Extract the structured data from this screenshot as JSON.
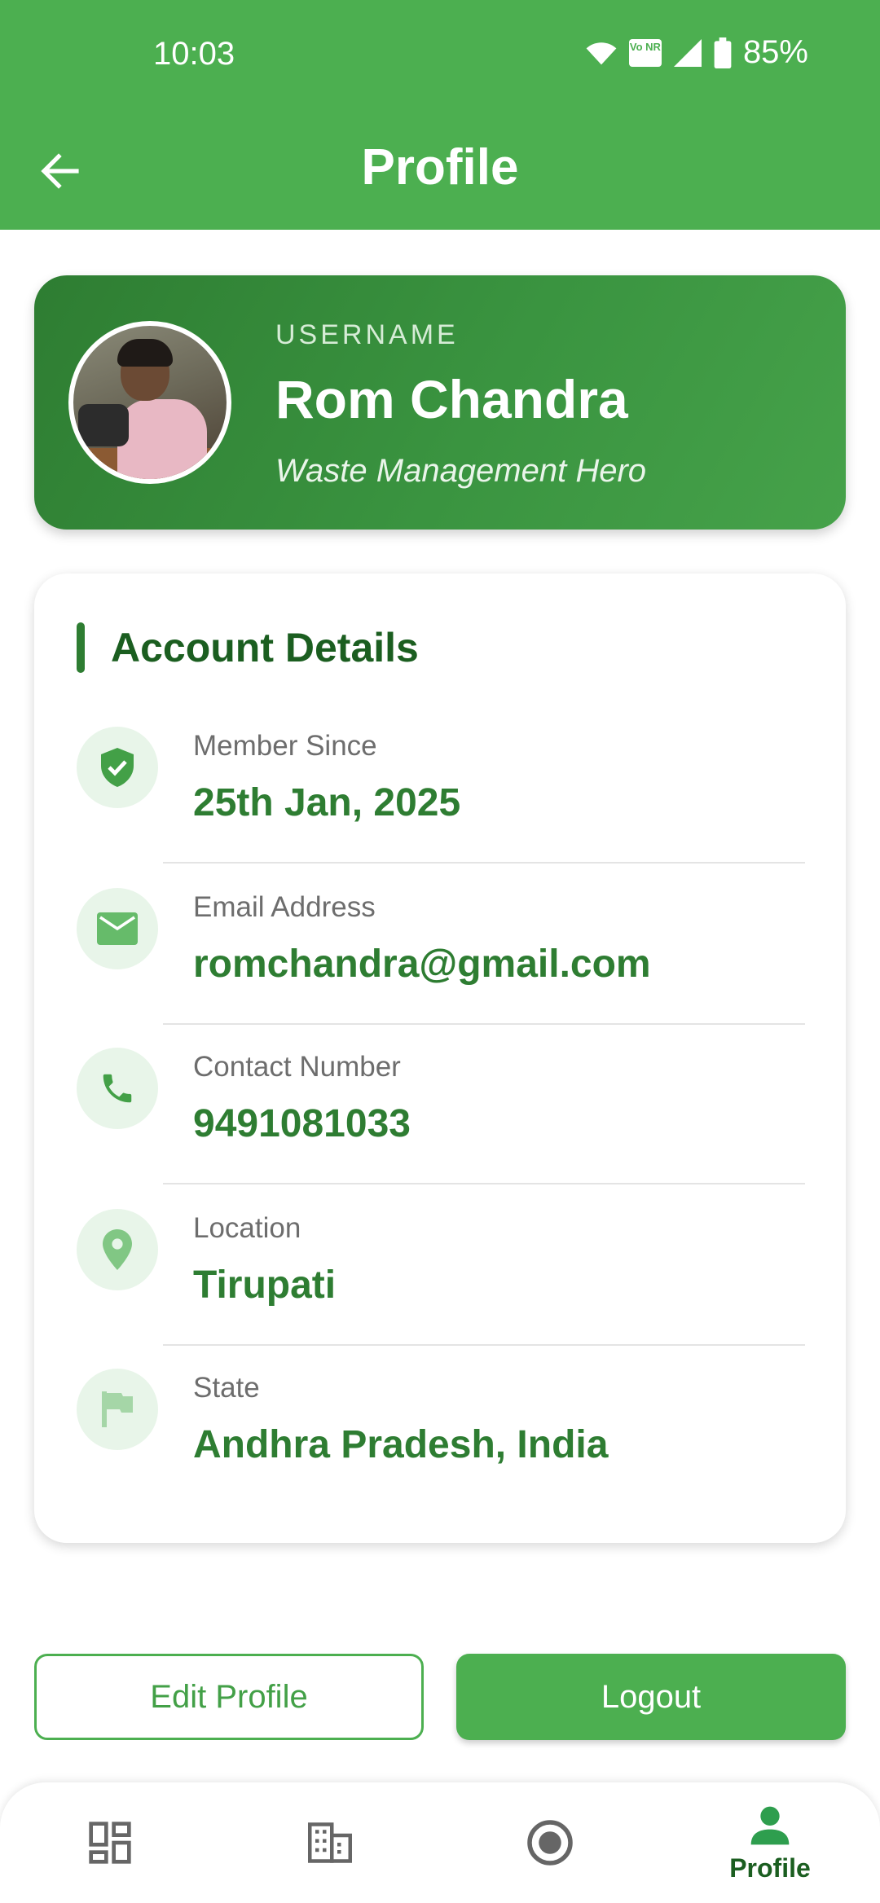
{
  "status_bar": {
    "time": "10:03",
    "volte_label": "Vo NR",
    "battery_percent": "85%"
  },
  "app_bar": {
    "title": "Profile",
    "back_icon": "arrow-left-icon"
  },
  "profile": {
    "caption": "USERNAME",
    "name": "Rom Chandra",
    "tagline": "Waste Management Hero"
  },
  "account_details": {
    "title": "Account Details",
    "items": [
      {
        "icon": "shield-check-icon",
        "label": "Member Since",
        "value": "25th Jan, 2025"
      },
      {
        "icon": "mail-icon",
        "label": "Email Address",
        "value": "romchandra@gmail.com"
      },
      {
        "icon": "phone-icon",
        "label": "Contact Number",
        "value": "9491081033"
      },
      {
        "icon": "location-pin-icon",
        "label": "Location",
        "value": "Tirupati"
      },
      {
        "icon": "flag-icon",
        "label": "State",
        "value": "Andhra Pradesh, India"
      }
    ]
  },
  "actions": {
    "edit_label": "Edit Profile",
    "logout_label": "Logout"
  },
  "bottom_nav": {
    "items": [
      {
        "icon": "dashboard-icon",
        "label": ""
      },
      {
        "icon": "building-icon",
        "label": ""
      },
      {
        "icon": "record-icon",
        "label": ""
      },
      {
        "icon": "person-icon",
        "label": "Profile",
        "active": true
      }
    ]
  },
  "colors": {
    "primary": "#4caf50",
    "primary_dark": "#2e7d32",
    "text_green": "#2e7d32",
    "icon_bg": "#e8f5e9"
  }
}
